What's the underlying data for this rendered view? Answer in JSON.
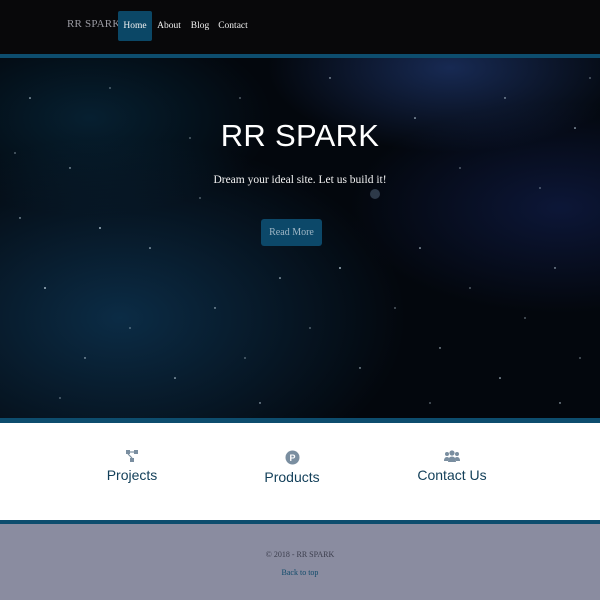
{
  "navbar": {
    "brand": "RR SPARK",
    "items": [
      {
        "label": "Home",
        "active": true
      },
      {
        "label": "About",
        "active": false
      },
      {
        "label": "Blog",
        "active": false
      },
      {
        "label": "Contact",
        "active": false
      }
    ]
  },
  "hero": {
    "title": "RR SPARK",
    "subtitle": "Dream your ideal site. Let us build it!",
    "button_label": "Read More"
  },
  "features": [
    {
      "label": "Projects",
      "icon": "sitemap-icon"
    },
    {
      "label": "Products",
      "icon": "product-p-icon"
    },
    {
      "label": "Contact Us",
      "icon": "users-icon"
    }
  ],
  "footer": {
    "copyright": "© 2018 - RR SPARK",
    "back_to_top": "Back to top"
  },
  "colors": {
    "accent": "#0d4d6e",
    "active_nav": "#0b4766",
    "navbar_bg": "#08080a",
    "footer_bg": "#8a8ca0",
    "feature_text": "#123f59"
  }
}
